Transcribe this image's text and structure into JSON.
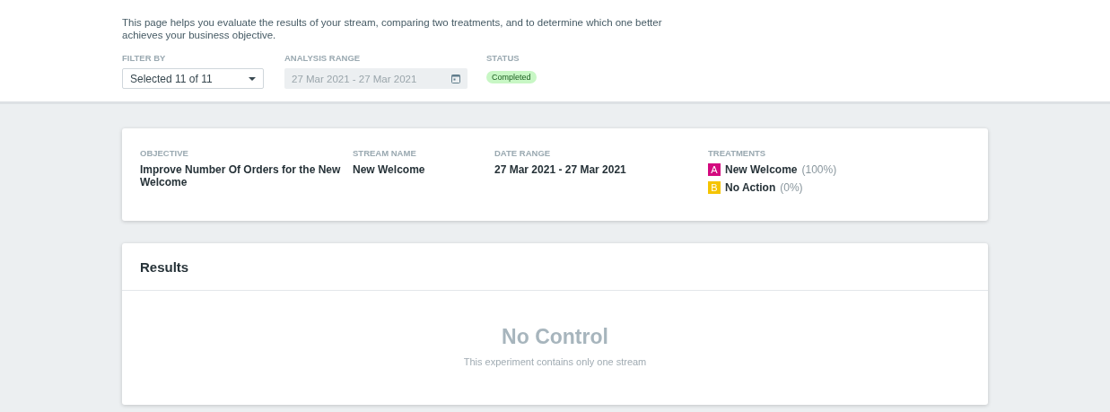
{
  "header": {
    "description": "This page helps you evaluate the results of your stream, comparing two treatments, and to determine which one better achieves your business objective."
  },
  "filters": {
    "filter_by": {
      "label": "FILTER BY",
      "value": "Selected 11 of 11"
    },
    "analysis_range": {
      "label": "ANALYSIS RANGE",
      "value": "27 Mar 2021 - 27 Mar 2021",
      "disabled": true
    },
    "status": {
      "label": "STATUS",
      "value": "Completed"
    }
  },
  "summary": {
    "objective": {
      "label": "OBJECTIVE",
      "value": "Improve Number Of Orders for the New Welcome"
    },
    "stream_name": {
      "label": "STREAM NAME",
      "value": "New Welcome"
    },
    "date_range": {
      "label": "DATE RANGE",
      "value": "27 Mar 2021 - 27 Mar 2021"
    },
    "treatments_label": "TREATMENTS",
    "treatments": [
      {
        "letter": "A",
        "name": "New Welcome",
        "share": "(100%)",
        "color": "#d3097f"
      },
      {
        "letter": "B",
        "name": "No Action",
        "share": "(0%)",
        "color": "#f5c400"
      }
    ]
  },
  "results": {
    "title": "Results",
    "empty_title": "No Control",
    "empty_text": "This experiment contains only one stream"
  }
}
